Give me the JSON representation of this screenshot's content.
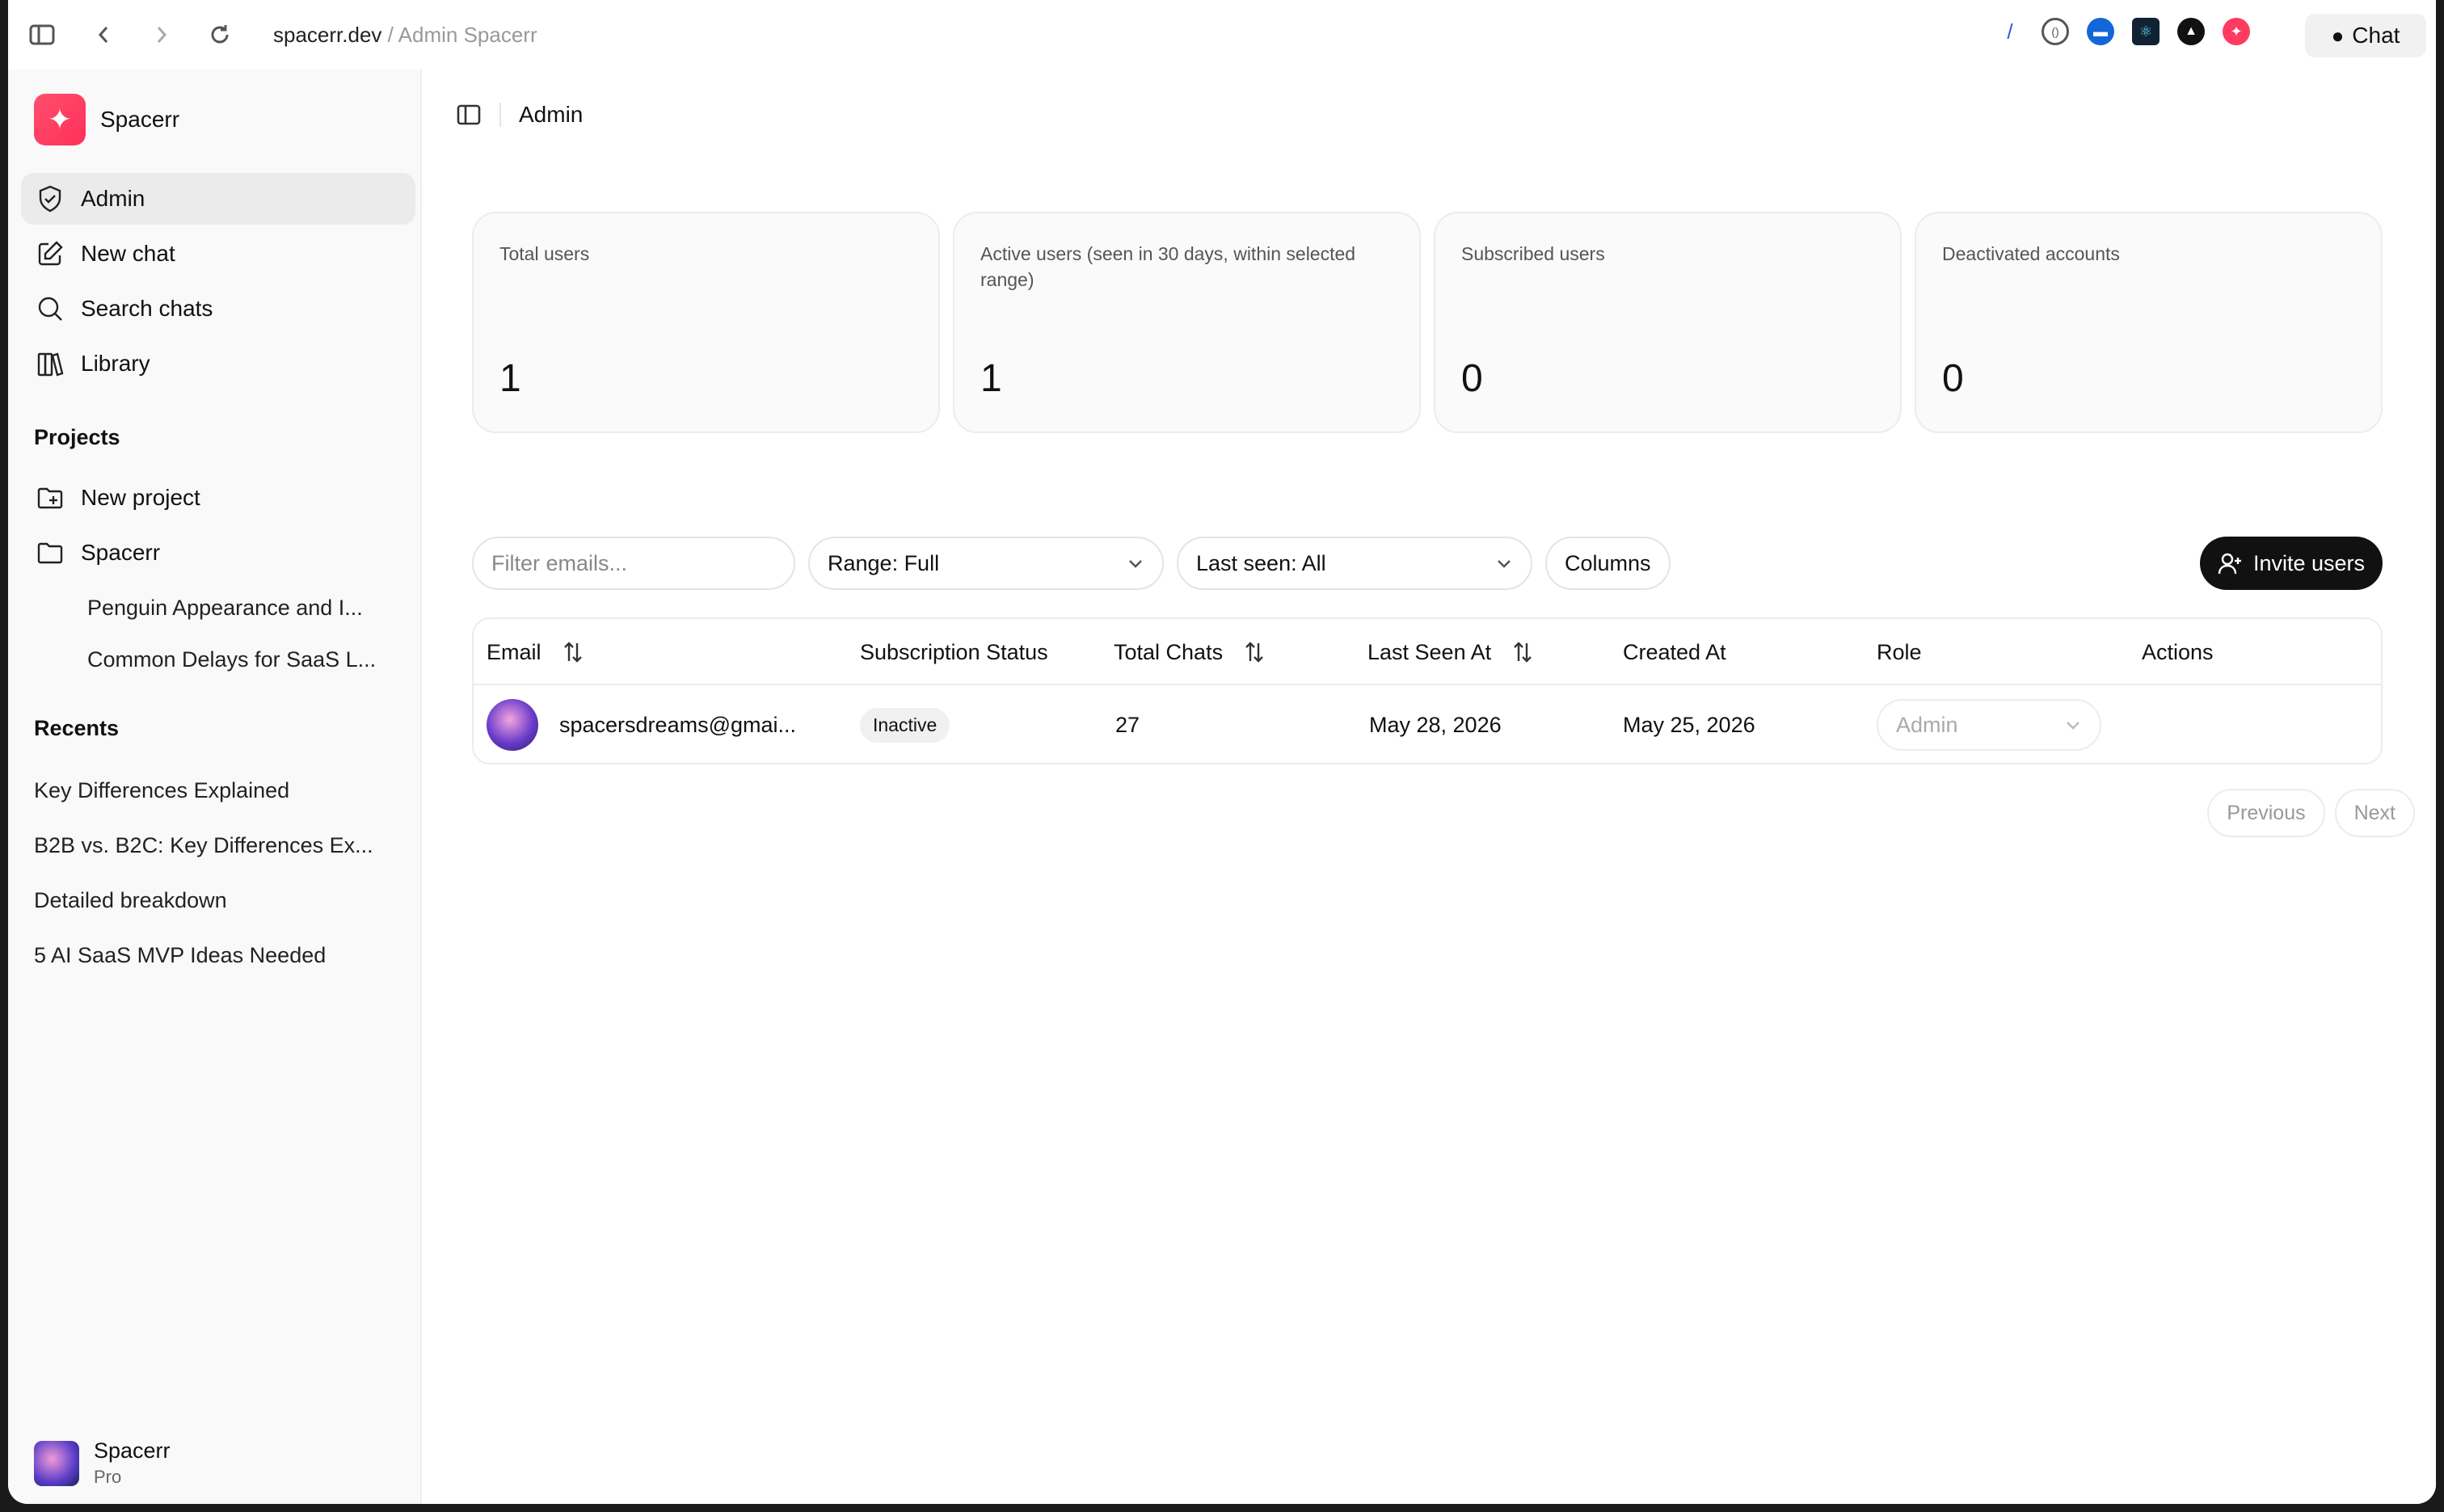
{
  "browser": {
    "domain": "spacerr.dev",
    "separator": " / ",
    "page_title": "Admin Spacerr",
    "chat_label": "Chat"
  },
  "sidebar": {
    "brand": "Spacerr",
    "nav": [
      {
        "label": "Admin",
        "icon": "shield-check-icon",
        "active": true
      },
      {
        "label": "New chat",
        "icon": "edit-icon"
      },
      {
        "label": "Search chats",
        "icon": "search-icon"
      },
      {
        "label": "Library",
        "icon": "library-icon"
      }
    ],
    "projects_title": "Projects",
    "projects": [
      {
        "label": "New project",
        "icon": "folder-plus-icon"
      },
      {
        "label": "Spacerr",
        "icon": "folder-icon"
      }
    ],
    "project_items": [
      "Penguin Appearance and I...",
      "Common Delays for SaaS L..."
    ],
    "recents_title": "Recents",
    "recents": [
      "Key Differences Explained",
      "B2B vs. B2C: Key Differences Ex...",
      "Detailed breakdown",
      "5 AI SaaS MVP Ideas Needed"
    ],
    "user": {
      "name": "Spacerr",
      "plan": "Pro"
    }
  },
  "main": {
    "breadcrumb": "Admin",
    "stats": [
      {
        "label": "Total users",
        "value": "1"
      },
      {
        "label": "Active users (seen in 30 days, within selected range)",
        "value": "1"
      },
      {
        "label": "Subscribed users",
        "value": "0"
      },
      {
        "label": "Deactivated accounts",
        "value": "0"
      }
    ],
    "filter_placeholder": "Filter emails...",
    "range_select": "Range: Full",
    "last_seen_select": "Last seen: All",
    "columns_label": "Columns",
    "invite_label": "Invite users",
    "table": {
      "headers": {
        "email": "Email",
        "subscription": "Subscription Status",
        "total_chats": "Total Chats",
        "last_seen": "Last Seen At",
        "created": "Created At",
        "role": "Role",
        "actions": "Actions"
      },
      "rows": [
        {
          "email": "spacersdreams@gmai...",
          "subscription": "Inactive",
          "total_chats": "27",
          "last_seen": "May 28, 2026",
          "created": "May 25, 2026",
          "role": "Admin"
        }
      ]
    },
    "pager": {
      "previous": "Previous",
      "next": "Next"
    }
  },
  "colors": {
    "accent": "#ff3b5f",
    "dark_button": "#111111"
  }
}
